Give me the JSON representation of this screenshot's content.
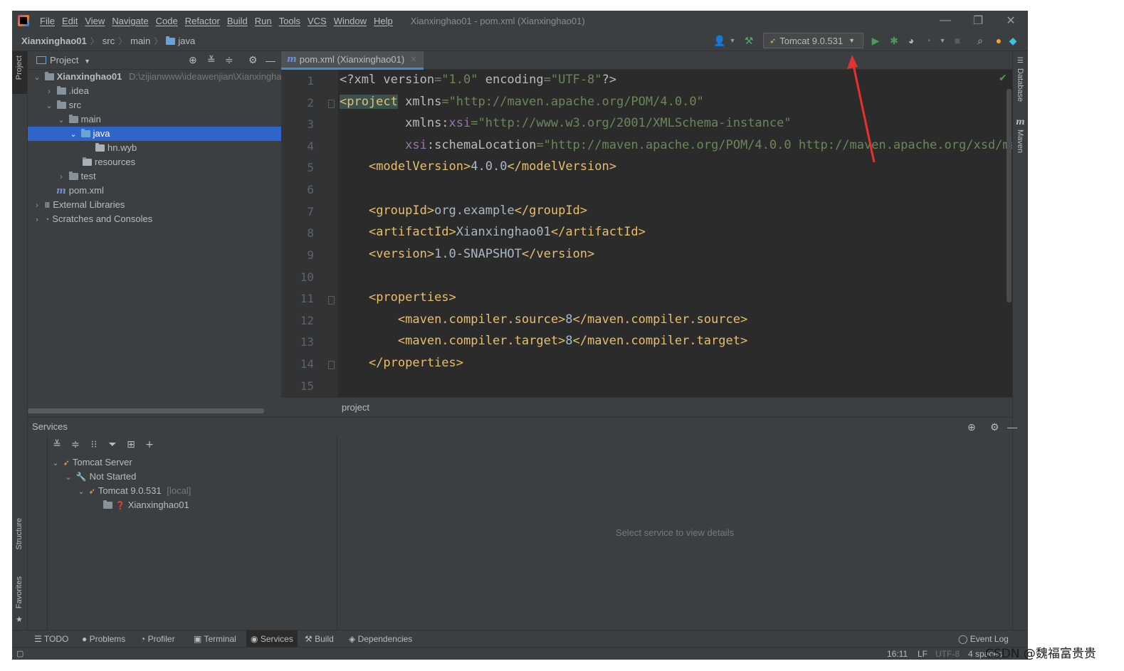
{
  "menubar": {
    "items": [
      "File",
      "Edit",
      "View",
      "Navigate",
      "Code",
      "Refactor",
      "Build",
      "Run",
      "Tools",
      "VCS",
      "Window",
      "Help"
    ],
    "window_title": "Xianxinghao01 - pom.xml (Xianxinghao01)",
    "controls": {
      "minimize": "—",
      "restore": "❐",
      "close": "✕"
    }
  },
  "navbar": {
    "breadcrumb": [
      "Xianxinghao01",
      "src",
      "main",
      "java"
    ],
    "run_config": "Tomcat 9.0.531",
    "icons": [
      "user-icon",
      "build-hammer-icon",
      "run-icon",
      "debug-icon",
      "coverage-icon",
      "profile-icon",
      "stop-icon",
      "search-icon",
      "update-icon",
      "toolbox-icon"
    ]
  },
  "left_strip": {
    "project": "Project",
    "structure": "Structure",
    "favorites": "Favorites"
  },
  "right_strip": {
    "database": "Database",
    "maven": "Maven"
  },
  "project_panel": {
    "title": "Project",
    "tree": [
      {
        "label": "Xianxinghao01",
        "suffix": "D:\\zijianwww\\ideawenjian\\Xianxinghao",
        "depth": 0,
        "expanded": true,
        "icon": "module-icon",
        "bold": true
      },
      {
        "label": ".idea",
        "depth": 1,
        "expanded": false,
        "icon": "folder-icon"
      },
      {
        "label": "src",
        "depth": 1,
        "expanded": true,
        "icon": "folder-icon"
      },
      {
        "label": "main",
        "depth": 2,
        "expanded": true,
        "icon": "folder-icon"
      },
      {
        "label": "java",
        "depth": 3,
        "expanded": true,
        "icon": "source-folder-icon",
        "selected": true
      },
      {
        "label": "hn.wyb",
        "depth": 4,
        "icon": "package-icon"
      },
      {
        "label": "resources",
        "depth": 3,
        "icon": "resources-folder-icon"
      },
      {
        "label": "test",
        "depth": 2,
        "expanded": false,
        "icon": "folder-icon"
      },
      {
        "label": "pom.xml",
        "depth": 1,
        "icon": "maven-icon"
      },
      {
        "label": "External Libraries",
        "depth": 0,
        "expanded": false,
        "icon": "libraries-icon"
      },
      {
        "label": "Scratches and Consoles",
        "depth": 0,
        "expanded": false,
        "icon": "scratches-icon"
      }
    ]
  },
  "editor": {
    "tab_label": "pom.xml (Xianxinghao01)",
    "line_numbers": [
      "1",
      "2",
      "3",
      "4",
      "5",
      "6",
      "7",
      "8",
      "9",
      "10",
      "11",
      "12",
      "13",
      "14",
      "15"
    ],
    "breadcrumb": "project"
  },
  "services": {
    "title": "Services",
    "tree": [
      {
        "label": "Tomcat Server",
        "depth": 0,
        "icon": "tomcat-icon"
      },
      {
        "label": "Not Started",
        "depth": 1,
        "icon": "wrench-icon"
      },
      {
        "label": "Tomcat 9.0.531",
        "suffix": "[local]",
        "depth": 2,
        "icon": "tomcat-icon"
      },
      {
        "label": "Xianxinghao01",
        "depth": 3,
        "icon": "artifact-icon"
      }
    ],
    "empty_message": "Select service to view details"
  },
  "bottom_tabs": [
    "TODO",
    "Problems",
    "Profiler",
    "Terminal",
    "Services",
    "Build",
    "Dependencies"
  ],
  "event_log": "Event Log",
  "status": {
    "position": "16:11",
    "line_sep": "LF",
    "encoding": "UTF-8",
    "indent": "4 spaces"
  },
  "watermark": "CSDN @魏福富贵贵",
  "colors": {
    "accent": "#2f65ca",
    "annotation_arrow": "#e8312f"
  }
}
